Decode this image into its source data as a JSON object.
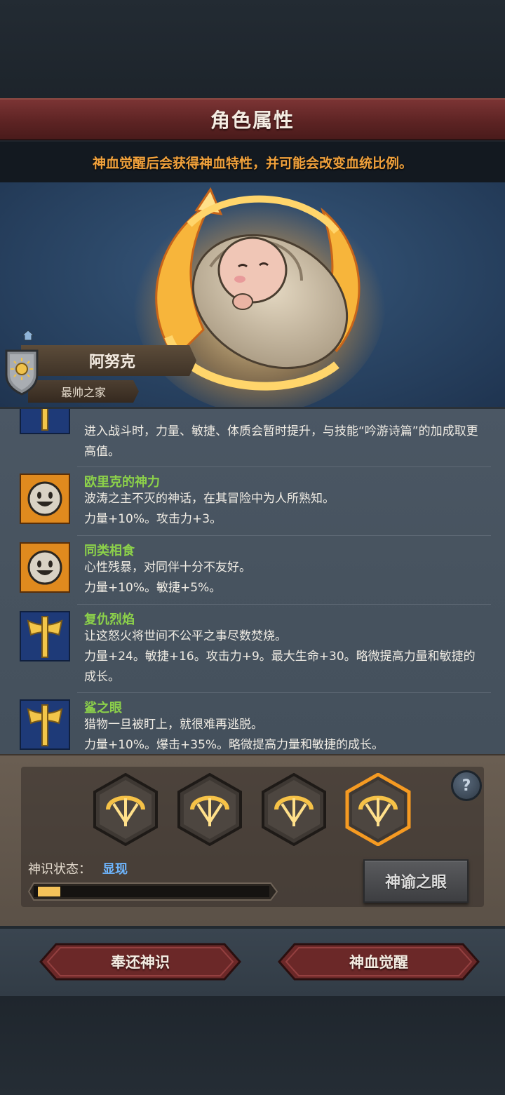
{
  "header": {
    "title": "角色属性",
    "notice": "神血觉醒后会获得神血特性，并可能会改变血统比例。"
  },
  "character": {
    "name": "阿努克",
    "family": "最帅之家"
  },
  "traits": {
    "items": [
      {
        "name": "",
        "icon": "axe-icon",
        "description": "进入战斗时，力量、敏捷、体质会暂时提升，与技能“吟游诗篇”的加成取更高值。"
      },
      {
        "name": "欧里克的神力",
        "icon": "smiley-face-icon",
        "description": "波涛之主不灭的神话，在其冒险中为人所熟知。",
        "effect": "力量+10%。攻击力+3。"
      },
      {
        "name": "同类相食",
        "icon": "smiley-face-icon",
        "description": "心性残暴，对同伴十分不友好。",
        "effect": "力量+10%。敏捷+5%。"
      },
      {
        "name": "复仇烈焰",
        "icon": "axe-icon",
        "description": "让这怒火将世间不公平之事尽数焚烧。",
        "effect": "力量+24。敏捷+16。攻击力+9。最大生命+30。略微提高力量和敏捷的成长。"
      },
      {
        "name": "鲨之眼",
        "icon": "axe-icon",
        "description": "猎物一旦被盯上，就很难再逃脱。",
        "effect": "力量+10%。爆击+35%。略微提高力量和敏捷的成长。"
      }
    ]
  },
  "divine": {
    "slots": [
      "trident-flame-icon",
      "trident-flame-icon",
      "trident-flame-icon",
      "trident-flame-icon"
    ],
    "selected_slot": 4,
    "status_label": "神识状态：",
    "status_value": "显现",
    "progress": 0.1,
    "help_label": "?",
    "oracle_button": "神谕之眼"
  },
  "actions": {
    "return_button": "奉还神识",
    "awaken_button": "神血觉醒"
  },
  "colors": {
    "banner_red": "#5e2424",
    "trait_name_green": "#8cd14a",
    "notice_orange": "#f2a23c",
    "status_blue": "#6eb6ff",
    "progress_fill": "#f5c35a"
  }
}
